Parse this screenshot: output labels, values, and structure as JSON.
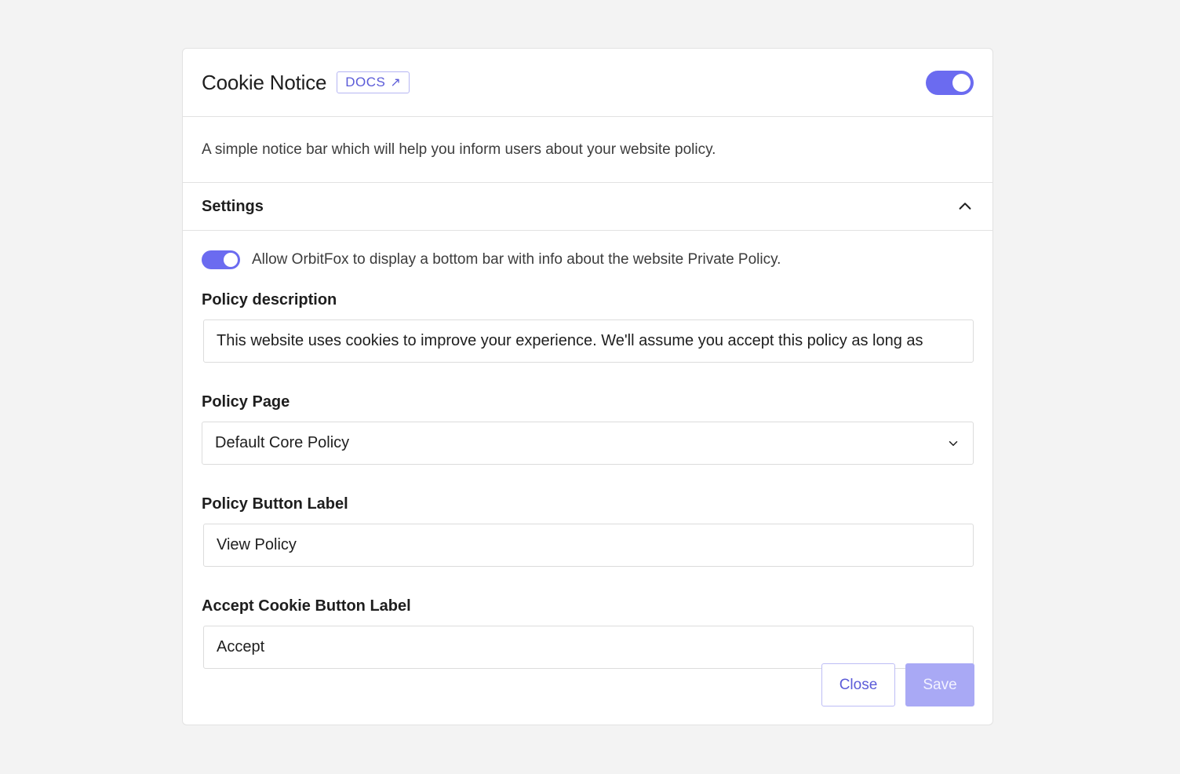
{
  "header": {
    "title": "Cookie Notice",
    "docs_label": "DOCS",
    "docs_icon": "external-link-arrow",
    "enabled": true
  },
  "description": "A simple notice bar which will help you inform users about your website policy.",
  "settings": {
    "title": "Settings",
    "expanded": true,
    "allow_toggle_on": true,
    "allow_text": "Allow OrbitFox to display a bottom bar with info about the website Private Policy.",
    "fields": {
      "policy_description": {
        "label": "Policy description",
        "value": "This website uses cookies to improve your experience. We'll assume you accept this policy as long as"
      },
      "policy_page": {
        "label": "Policy Page",
        "selected": "Default Core Policy"
      },
      "policy_button_label": {
        "label": "Policy Button Label",
        "value": "View Policy"
      },
      "accept_button_label": {
        "label": "Accept Cookie Button Label",
        "value": "Accept"
      }
    }
  },
  "actions": {
    "close_label": "Close",
    "save_label": "Save"
  },
  "colors": {
    "accent": "#6b6bf0",
    "save_disabled": "#a9a9f5",
    "background": "#f3f3f3"
  }
}
